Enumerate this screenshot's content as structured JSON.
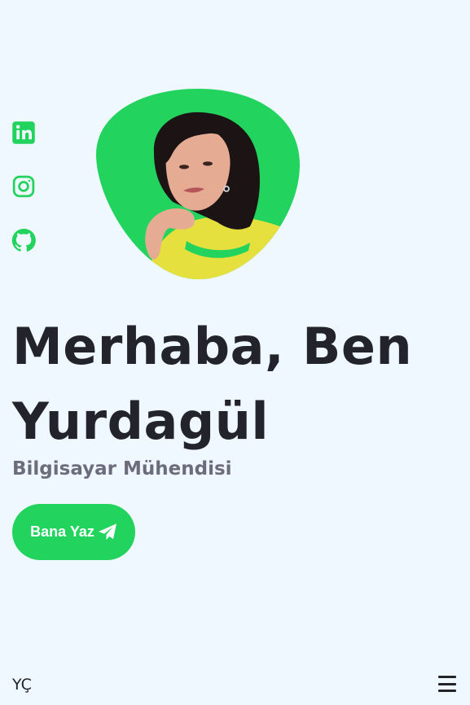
{
  "social": [
    {
      "name": "linkedin",
      "icon": "linkedin-icon"
    },
    {
      "name": "instagram",
      "icon": "instagram-icon"
    },
    {
      "name": "github",
      "icon": "github-icon"
    }
  ],
  "hero": {
    "title_line1": "Merhaba, Ben",
    "title_line2": "Yurdagül",
    "subtitle": "Bilgisayar Mühendisi",
    "cta_label": "Bana Yaz",
    "cta_icon": "send-icon",
    "portrait_icon": "profile-photo"
  },
  "footer": {
    "logo": "YÇ",
    "menu_icon": "menu-icon"
  },
  "colors": {
    "accent": "#22d45d",
    "background": "#eff7ff",
    "text": "#23232b",
    "subtitle": "#6d6c7c"
  }
}
